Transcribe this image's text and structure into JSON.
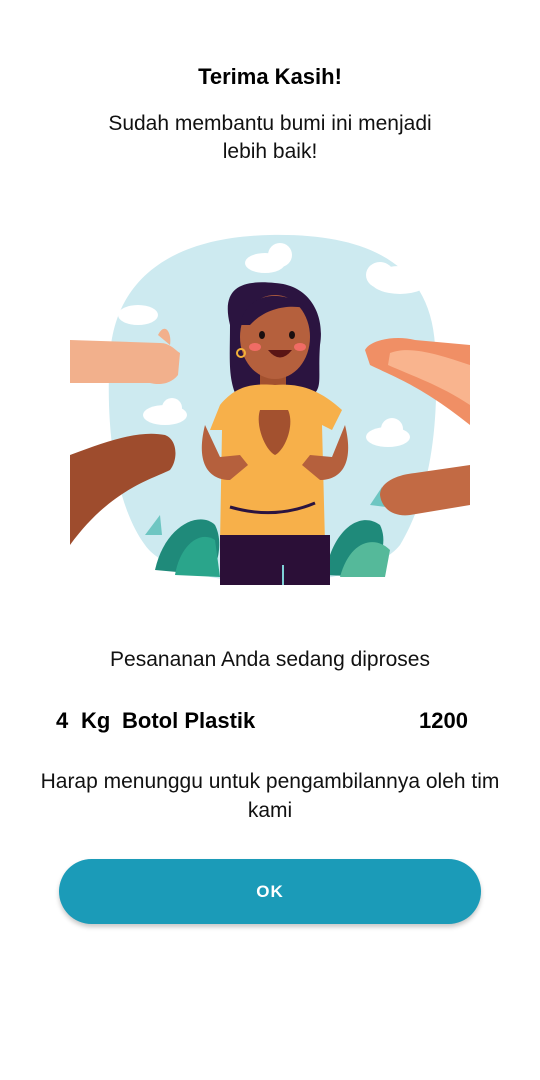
{
  "dialog": {
    "title": "Terima Kasih!",
    "subtitle": "Sudah membantu bumi ini menjadi lebih baik!",
    "illustration_icon": "thankful-woman-thumbs-up-illustration",
    "status": "Pesananan Anda sedang diproses",
    "order": {
      "quantity": "4",
      "unit": "Kg",
      "item": "Botol Plastik",
      "points": "1200"
    },
    "note": "Harap menunggu untuk pengambilannya oleh tim kami",
    "ok_label": "OK",
    "colors": {
      "button": "#1b9bb8",
      "illustration_bg": "#cdeaf0",
      "shirt": "#f7b04a",
      "hair": "#2b1440",
      "skin_main": "#b5603d"
    }
  }
}
